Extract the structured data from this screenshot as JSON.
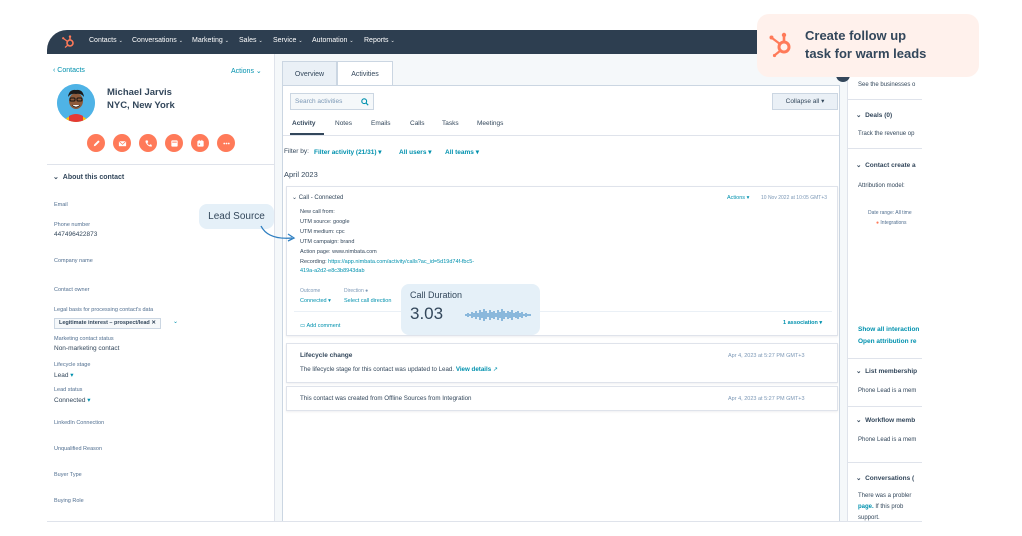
{
  "nav": {
    "items": [
      "Contacts",
      "Conversations",
      "Marketing",
      "Sales",
      "Service",
      "Automation",
      "Reports"
    ]
  },
  "contact": {
    "back_label": "Contacts",
    "actions_label": "Actions",
    "name": "Michael Jarvis",
    "location": "NYC, New York"
  },
  "quick_actions": [
    "note-icon",
    "email-icon",
    "call-icon",
    "task-icon",
    "meeting-icon",
    "more-icon"
  ],
  "about": {
    "header": "About this contact",
    "email_label": "Email",
    "phone_label": "Phone number",
    "phone_value": "447496422873",
    "company_label": "Company name",
    "owner_label": "Contact owner",
    "legal_label": "Legal basis for processing contact's data",
    "legal_value": "Legitimate interest – prospect/lead",
    "marketing_label": "Marketing contact status",
    "marketing_value": "Non-marketing contact",
    "lifecycle_label": "Lifecycle stage",
    "lifecycle_value": "Lead",
    "lead_status_label": "Lead status",
    "lead_status_value": "Connected",
    "linkedin_label": "LinkedIn Connection",
    "unqualified_label": "Unqualified Reason",
    "buyer_type_label": "Buyer Type",
    "buying_role_label": "Buying Role"
  },
  "tabs": {
    "overview": "Overview",
    "activities": "Activities"
  },
  "activity": {
    "search_placeholder": "Search activities",
    "collapse_all": "Collapse all",
    "subtabs": [
      "Activity",
      "Notes",
      "Emails",
      "Calls",
      "Tasks",
      "Meetings"
    ],
    "filter_label": "Filter by:",
    "filter_activity": "Filter activity (21/31)",
    "filter_users": "All users",
    "filter_teams": "All teams",
    "month": "April 2023"
  },
  "call_card": {
    "title": "Call - Connected",
    "actions": "Actions",
    "timestamp": "10 Nov 2022 at 10:05 GMT+3",
    "lines": [
      "New call from:",
      "UTM source: google",
      "UTM medium: cpc",
      "UTM campaign: brand",
      "Action page: www.nimbata.com"
    ],
    "recording_label": "Recording:",
    "recording_url_1": "https://app.nimbata.com/activity/calls?ac_id=5d19d74f-fbc5-",
    "recording_url_2": "419a-a2d2-e8c3b8943dab",
    "outcome_label": "Outcome",
    "outcome_value": "Connected",
    "direction_label": "Direction",
    "direction_value": "Select call direction",
    "add_comment": "Add comment",
    "association": "1 association"
  },
  "lifecycle_card": {
    "title": "Lifecycle change",
    "timestamp": "Apr 4, 2023 at 5:27 PM GMT+3",
    "text": "The lifecycle stage for this contact was updated to Lead.",
    "link": "View details"
  },
  "created_card": {
    "text": "This contact was created from Offline Sources from Integration",
    "timestamp": "Apr 4, 2023 at 5:27 PM GMT+3"
  },
  "right": {
    "businesses_text": "See the businesses o",
    "deals_head": "Deals (0)",
    "deals_text": "Track the revenue op",
    "contact_create_head": "Contact create a",
    "attribution_label": "Attribution model:",
    "date_range": "Date range: All time",
    "integrations": "Integrations",
    "show_all": "Show all interaction",
    "open_attribution": "Open attribution re",
    "list_head": "List membership",
    "list_text": "Phone Lead is a mem",
    "workflow_head": "Workflow memb",
    "workflow_text": "Phone Lead is a mem",
    "conversations_head": "Conversations (",
    "conv_text_1": "There was a probler",
    "conv_text_2_link": "page.",
    "conv_text_2": "If this prob",
    "conv_text_3": "support."
  },
  "callouts": {
    "task_line1": "Create follow up",
    "task_line2": "task for warm leads",
    "lead_source": "Lead Source",
    "call_duration_label": "Call Duration",
    "call_duration_value": "3.03"
  },
  "colors": {
    "nav_bg": "#2d3e50",
    "accent_orange": "#ff7a59",
    "link_blue": "#0091ae",
    "callout_blue": "#e5f0f8",
    "callout_peach": "#fff1ec"
  }
}
